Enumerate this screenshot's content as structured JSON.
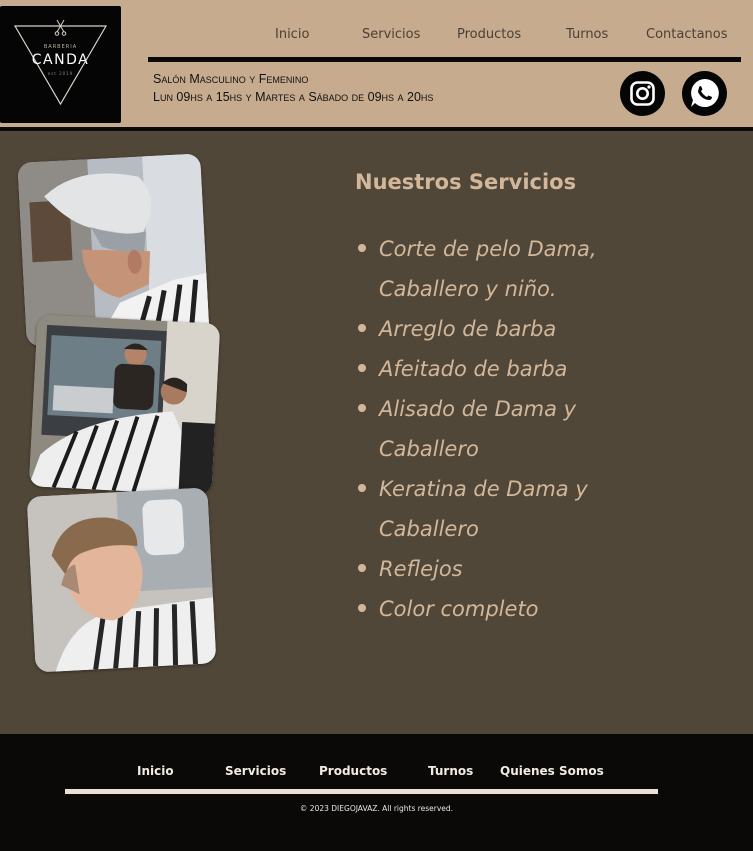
{
  "brand": {
    "small": "BARBERIA",
    "name": "CANDA",
    "tiny": "est 2019"
  },
  "nav": [
    "Inicio",
    "Servicios",
    "Productos",
    "Turnos",
    "Contactanos"
  ],
  "header": {
    "tagline": "Salón Masculino y Femenino",
    "hours": "Lun 09hs a 15hs y Martes a Sábado de 09hs a 20hs"
  },
  "social": [
    "instagram-icon",
    "whatsapp-icon"
  ],
  "services": {
    "title": "Nuestros Servicios",
    "items": [
      "Corte de pelo Dama, Caballero y niño.",
      "Arreglo de barba",
      "Afeitado de barba",
      "Alisado de Dama y Caballero",
      "Keratina de Dama y Caballero",
      "Reflejos",
      "Color completo"
    ]
  },
  "footer": {
    "nav": [
      "Inicio",
      "Servicios",
      "Productos",
      "Turnos",
      "Quienes Somos"
    ],
    "copyright": "© 2023 DIEGOJAVAZ.  All rights reserved."
  },
  "colors": {
    "header_bg": "#c7ab8e",
    "main_bg": "#514739",
    "accent_text": "#d2b79a",
    "footer_bg": "#0a0908"
  }
}
